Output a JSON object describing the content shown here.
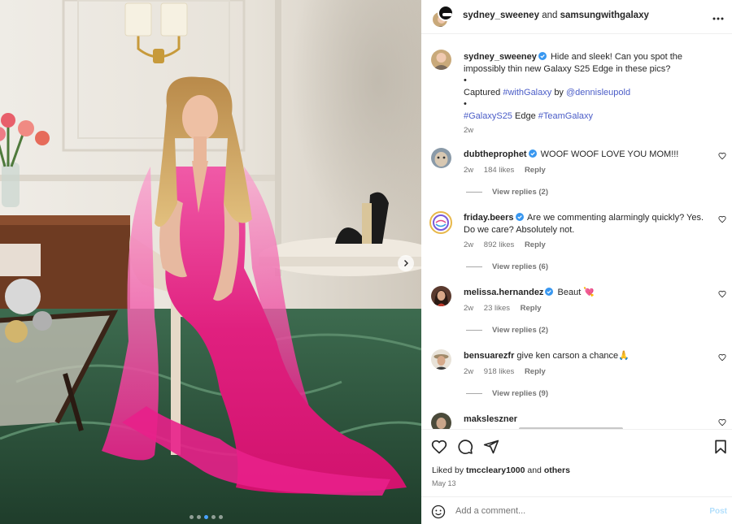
{
  "header": {
    "user1": "sydney_sweeney",
    "and": "and",
    "user2": "samsungwithgalaxy",
    "more_icon": "more-horizontal-icon"
  },
  "caption": {
    "username": "sydney_sweeney",
    "text1": "Hide and sleek! Can you spot the impossibly thin new Galaxy S25 Edge in these pics?",
    "bullet": "•",
    "captured": "Captured",
    "withgalaxy": "#withGalaxy",
    "by": "by",
    "mention": "@dennisleupold",
    "tag_s25": "#GalaxyS25",
    "edge": "Edge",
    "tag_team": "#TeamGalaxy",
    "time": "2w"
  },
  "comments": [
    {
      "username": "dubtheprophet",
      "verified": true,
      "text": "WOOF WOOF LOVE YOU MOM!!!",
      "time": "2w",
      "likes": "184 likes",
      "reply": "Reply",
      "view_replies": "View replies (2)"
    },
    {
      "username": "friday.beers",
      "verified": true,
      "text": "Are we commenting alarmingly quickly? Yes. Do we care? Absolutely not.",
      "time": "2w",
      "likes": "892 likes",
      "reply": "Reply",
      "view_replies": "View replies (6)"
    },
    {
      "username": "melissa.hernandez",
      "verified": true,
      "text": "Beaut 💘",
      "time": "2w",
      "likes": "23 likes",
      "reply": "Reply",
      "view_replies": "View replies (2)"
    },
    {
      "username": "bensuarezfr",
      "verified": false,
      "text": "give ken carson a chance🙏",
      "time": "2w",
      "likes": "918 likes",
      "reply": "Reply",
      "view_replies": "View replies (9)"
    },
    {
      "username": "maksleszner",
      "verified": false,
      "text": "",
      "time": "",
      "likes": "",
      "reply": "",
      "view_replies": ""
    }
  ],
  "actions": {
    "liked_by_prefix": "Liked by",
    "liked_by_user": "tmccleary1000",
    "liked_by_and": "and",
    "liked_by_others": "others",
    "date": "May 13"
  },
  "add_comment": {
    "placeholder": "Add a comment...",
    "post_label": "Post"
  },
  "colors": {
    "dress": "#e0207f",
    "link": "#4a5cc7",
    "verified": "#3897f0"
  },
  "carousel": {
    "total": 5,
    "current": 3
  }
}
